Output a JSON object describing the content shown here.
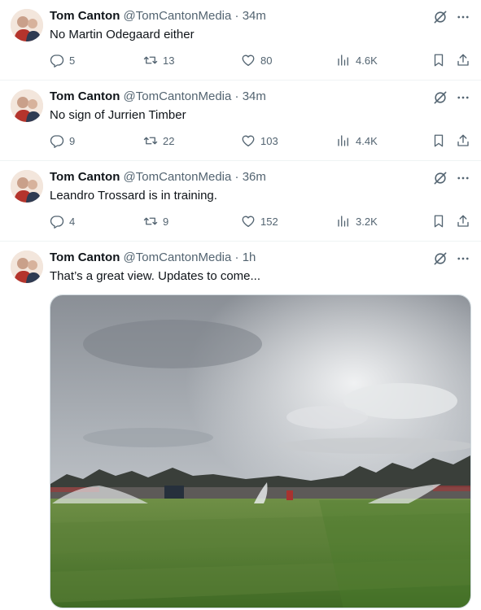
{
  "tweets": [
    {
      "author_name": "Tom Canton",
      "handle": "@TomCantonMedia",
      "separator": "·",
      "time": "34m",
      "text": "No Martin Odegaard either",
      "replies": "5",
      "retweets": "13",
      "likes": "80",
      "views": "4.6K"
    },
    {
      "author_name": "Tom Canton",
      "handle": "@TomCantonMedia",
      "separator": "·",
      "time": "34m",
      "text": "No sign of Jurrien Timber",
      "replies": "9",
      "retweets": "22",
      "likes": "103",
      "views": "4.4K"
    },
    {
      "author_name": "Tom Canton",
      "handle": "@TomCantonMedia",
      "separator": "·",
      "time": "36m",
      "text": "Leandro Trossard is in training.",
      "replies": "4",
      "retweets": "9",
      "likes": "152",
      "views": "3.2K"
    },
    {
      "author_name": "Tom Canton",
      "handle": "@TomCantonMedia",
      "separator": "·",
      "time": "1h",
      "text": "That’s a great view. Updates to come...",
      "media": "training-ground-photo"
    }
  ],
  "icons": {
    "grok": "grok-icon",
    "more": "more-icon",
    "reply": "reply-icon",
    "retweet": "retweet-icon",
    "like": "heart-icon",
    "views": "views-icon",
    "bookmark": "bookmark-icon",
    "share": "share-icon"
  },
  "colors": {
    "text_primary": "#0f1419",
    "text_secondary": "#536471",
    "divider": "#eff3f4"
  }
}
